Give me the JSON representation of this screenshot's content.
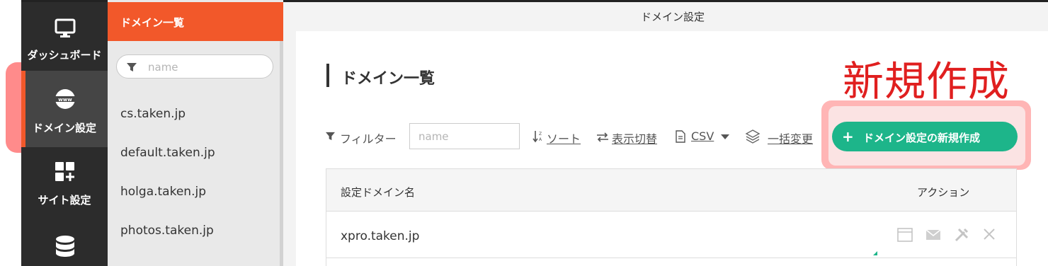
{
  "nav": {
    "items": [
      {
        "label": "ダッシュボード",
        "icon": "monitor-icon"
      },
      {
        "label": "ドメイン設定",
        "icon": "www-globe-icon"
      },
      {
        "label": "サイト設定",
        "icon": "grid-plus-icon"
      },
      {
        "label": "",
        "icon": "database-icon"
      }
    ],
    "active_index": 1
  },
  "list_panel": {
    "title": "ドメイン一覧",
    "search_placeholder": "name",
    "domains": [
      "cs.taken.jp",
      "default.taken.jp",
      "holga.taken.jp",
      "photos.taken.jp"
    ]
  },
  "topbar": {
    "title": "ドメイン設定"
  },
  "main": {
    "heading": "ドメイン一覧",
    "annotation": "新規作成",
    "toolbar": {
      "filter_label": "フィルター",
      "filter_placeholder": "name",
      "sort_label": "ソート",
      "toggle_view_label": "表示切替",
      "csv_label": "CSV",
      "bulk_edit_label": "一括変更",
      "new_button_label": "ドメイン設定の新規作成",
      "new_button_plus": "+"
    },
    "table": {
      "columns": [
        "設定ドメイン名",
        "アクション"
      ],
      "rows": [
        {
          "name": "xpro.taken.jp"
        }
      ]
    }
  },
  "colors": {
    "accent_orange": "#f2582a",
    "accent_green": "#1db58a",
    "annotation_red": "#e01f1f",
    "nav_bg": "#2c2c2c"
  }
}
